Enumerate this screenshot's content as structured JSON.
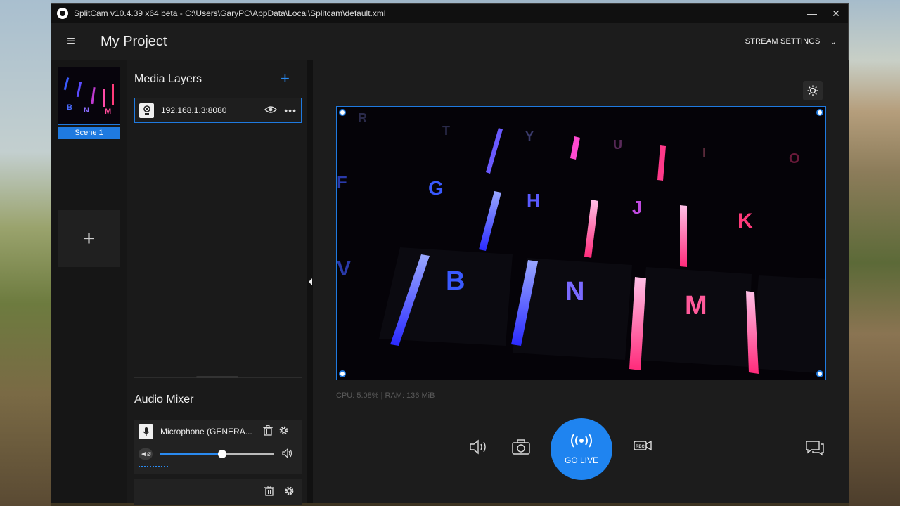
{
  "window": {
    "title": "SplitCam v10.4.39 x64 beta - C:\\Users\\GaryPC\\AppData\\Local\\Splitcam\\default.xml",
    "minimize": "—",
    "close": "✕"
  },
  "header": {
    "menu_icon": "≡",
    "project_title": "My Project",
    "stream_settings_label": "STREAM SETTINGS",
    "chevron": "⌄"
  },
  "scenes": {
    "items": [
      {
        "label": "Scene 1",
        "selected": true
      }
    ],
    "add_label": "+"
  },
  "layers": {
    "title": "Media Layers",
    "add_label": "+",
    "items": [
      {
        "name": "192.168.1.3:8080",
        "icon": "webcam-icon"
      }
    ]
  },
  "mixer": {
    "title": "Audio Mixer",
    "items": [
      {
        "name": "Microphone  (GENERA...",
        "icon": "microphone-icon",
        "volume": 0.55
      }
    ]
  },
  "preview": {
    "stats": "CPU: 5.08% | RAM: 136 MiB",
    "keyboard_letters": [
      "R",
      "T",
      "Y",
      "U",
      "I",
      "O",
      "F",
      "G",
      "H",
      "J",
      "K",
      "V",
      "B",
      "N",
      "M"
    ]
  },
  "controls": {
    "go_live_label": "GO LIVE"
  },
  "colors": {
    "accent": "#1f7ae0",
    "go_live": "#1f84f0"
  }
}
